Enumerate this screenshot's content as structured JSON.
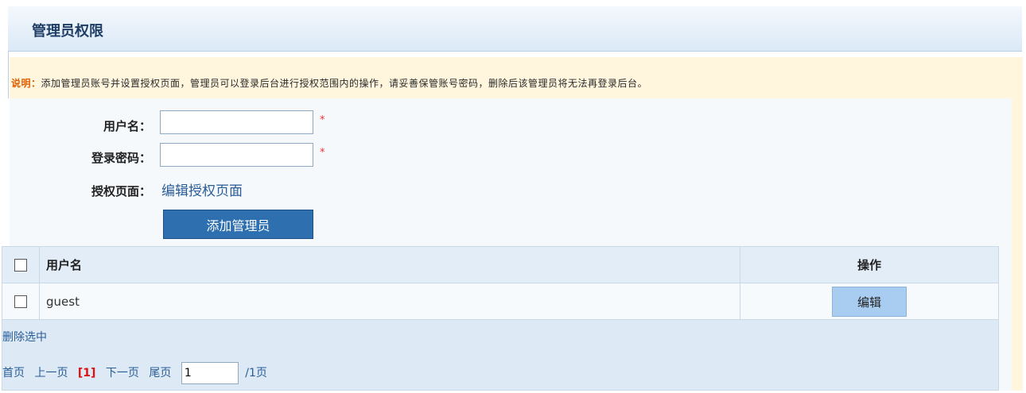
{
  "header": {
    "title": "管理员权限"
  },
  "notice": {
    "label": "说明：",
    "text": "添加管理员账号并设置授权页面，管理员可以登录后台进行授权范围内的操作，请妥善保管账号密码，删除后该管理员将无法再登录后台。"
  },
  "form": {
    "username_label": "用户名：",
    "username_value": "",
    "password_label": "登录密码：",
    "password_value": "",
    "required_mark": "*",
    "auth_label": "授权页面：",
    "auth_link": "编辑授权页面",
    "submit_label": "添加管理员"
  },
  "table": {
    "columns": [
      "用户名",
      "操作"
    ],
    "rows": [
      {
        "username": "guest",
        "action": "编辑"
      }
    ]
  },
  "footer": {
    "delete_selected": "删除选中",
    "first": "首页",
    "prev": "上一页",
    "current": "[1]",
    "next": "下一页",
    "last": "尾页",
    "page_input": "1",
    "total": "/1页"
  },
  "colors": {
    "header_text": "#1f3e66",
    "notice_bg": "#fff6dd",
    "notice_label": "#e15e00",
    "button_bg": "#2e6fb0",
    "edit_btn_bg": "#a9cdf0",
    "current_page": "#dd1111"
  }
}
